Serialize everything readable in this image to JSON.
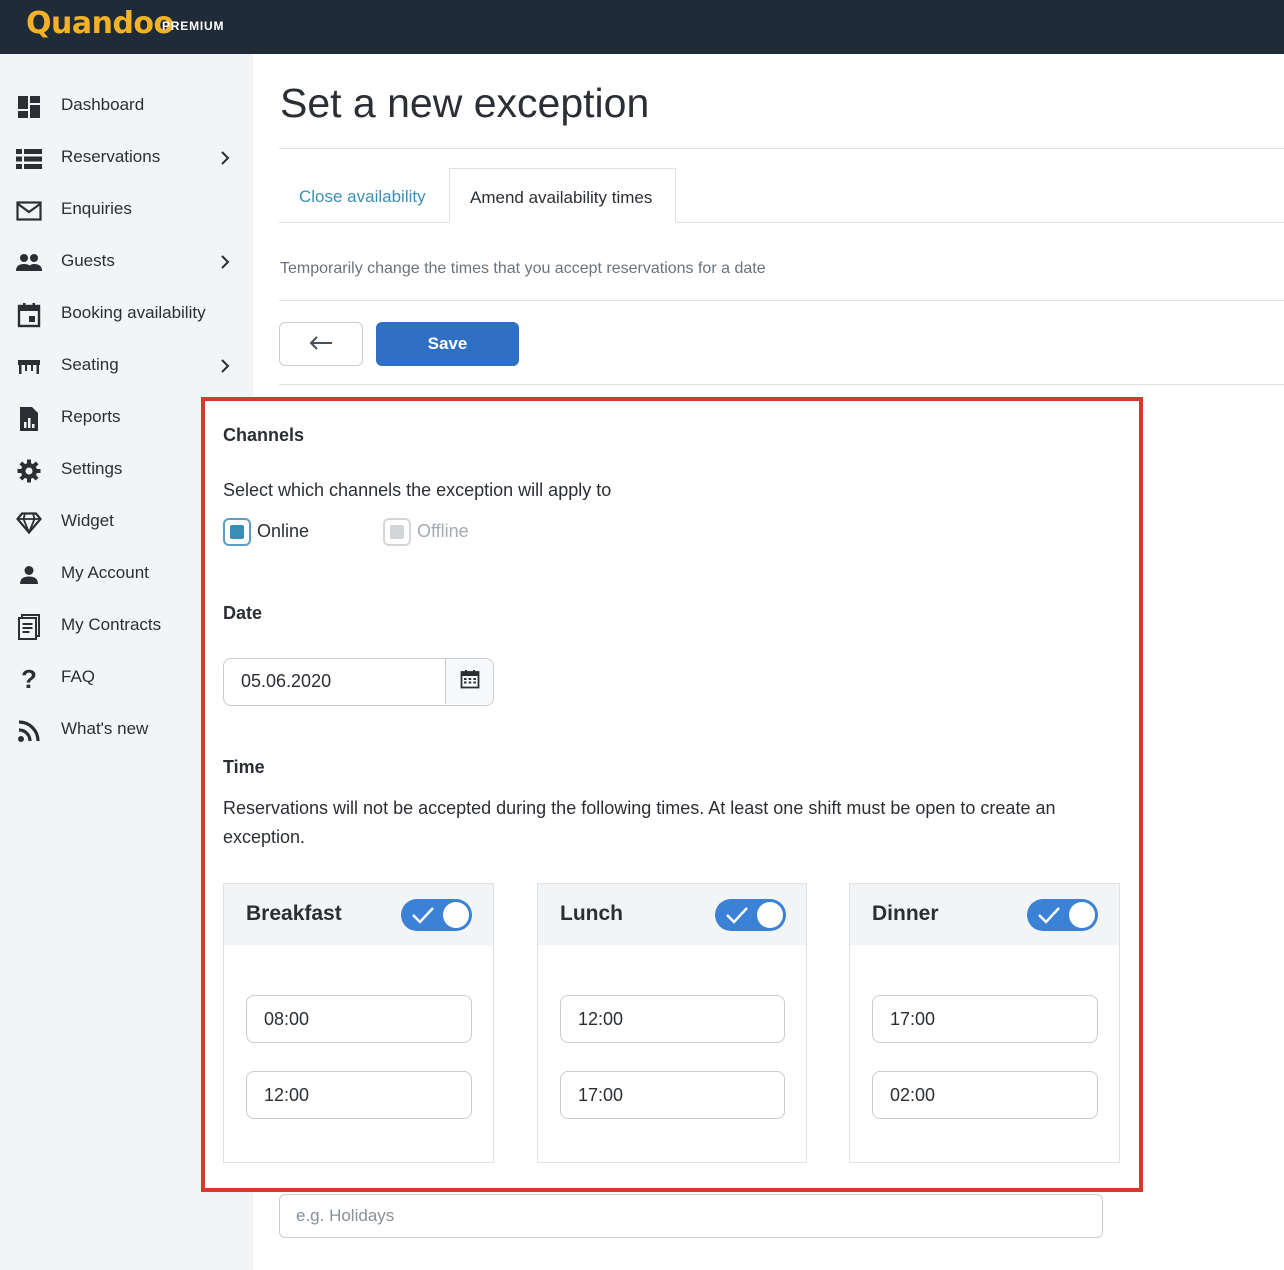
{
  "header": {
    "logo": "Quandoo",
    "badge": "PREMIUM"
  },
  "sidebar": {
    "items": [
      {
        "label": "Dashboard",
        "icon": "dashboard-icon",
        "has_children": false
      },
      {
        "label": "Reservations",
        "icon": "list-icon",
        "has_children": true
      },
      {
        "label": "Enquiries",
        "icon": "mail-icon",
        "has_children": false
      },
      {
        "label": "Guests",
        "icon": "people-icon",
        "has_children": true
      },
      {
        "label": "Booking availability",
        "icon": "calendar-icon",
        "has_children": false
      },
      {
        "label": "Seating",
        "icon": "table-icon",
        "has_children": true
      },
      {
        "label": "Reports",
        "icon": "report-icon",
        "has_children": false
      },
      {
        "label": "Settings",
        "icon": "gear-icon",
        "has_children": false
      },
      {
        "label": "Widget",
        "icon": "diamond-icon",
        "has_children": false
      },
      {
        "label": "My Account",
        "icon": "person-icon",
        "has_children": false
      },
      {
        "label": "My Contracts",
        "icon": "contract-icon",
        "has_children": false
      },
      {
        "label": "FAQ",
        "icon": "question-icon",
        "has_children": false
      },
      {
        "label": "What's new",
        "icon": "rss-icon",
        "has_children": false
      }
    ]
  },
  "main": {
    "title": "Set a new exception",
    "tabs": [
      {
        "label": "Close availability",
        "active": false
      },
      {
        "label": "Amend availability times",
        "active": true
      }
    ],
    "subtitle": "Temporarily change the times that you accept reservations for a date",
    "save_label": "Save",
    "channels": {
      "heading": "Channels",
      "description": "Select which channels the exception will apply to",
      "options": [
        {
          "label": "Online",
          "checked": true,
          "disabled": false
        },
        {
          "label": "Offline",
          "checked": false,
          "disabled": true
        }
      ]
    },
    "date": {
      "heading": "Date",
      "value": "05.06.2020"
    },
    "time": {
      "heading": "Time",
      "description": "Reservations will not be accepted during the following times. At least one shift must be open to create an exception.",
      "shifts": [
        {
          "name": "Breakfast",
          "enabled": true,
          "from": "08:00",
          "to": "12:00"
        },
        {
          "name": "Lunch",
          "enabled": true,
          "from": "12:00",
          "to": "17:00"
        },
        {
          "name": "Dinner",
          "enabled": true,
          "from": "17:00",
          "to": "02:00"
        }
      ]
    },
    "reason_placeholder": "e.g. Holidays"
  },
  "colors": {
    "brand": "#f2b126",
    "topbar": "#1f2b36",
    "primary": "#2f6fc4",
    "link": "#3a8fb7",
    "highlight": "#d63a2b"
  }
}
